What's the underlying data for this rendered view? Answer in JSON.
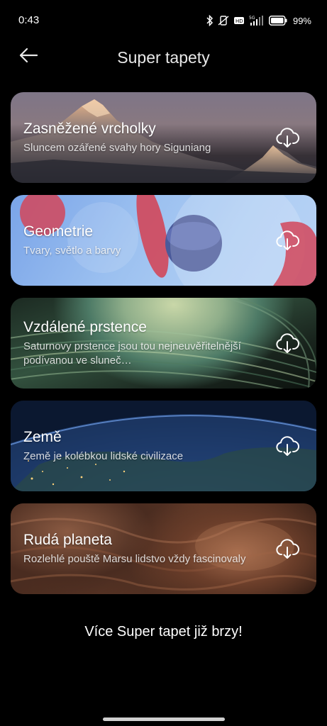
{
  "status_bar": {
    "time": "0:43",
    "battery": "99%",
    "network": "5G"
  },
  "header": {
    "title": "Super tapety"
  },
  "cards": [
    {
      "title": "Zasněžené vrcholky",
      "subtitle": "Sluncem ozářené svahy hory Siguniang",
      "icon": "cloud-download-icon"
    },
    {
      "title": "Geometrie",
      "subtitle": "Tvary, světlo a barvy",
      "icon": "cloud-download-icon"
    },
    {
      "title": "Vzdálené prstence",
      "subtitle": "Saturnovy prstence jsou tou nejneuvěřitelnější podívanou ve sluneč…",
      "icon": "cloud-download-icon"
    },
    {
      "title": "Země",
      "subtitle": "Země je kolébkou lidské civilizace",
      "icon": "cloud-download-icon"
    },
    {
      "title": "Rudá planeta",
      "subtitle": "Rozlehlé pouště Marsu lidstvo vždy fascinovaly",
      "icon": "cloud-download-icon"
    }
  ],
  "footer": {
    "text": "Více Super tapet již brzy!"
  }
}
